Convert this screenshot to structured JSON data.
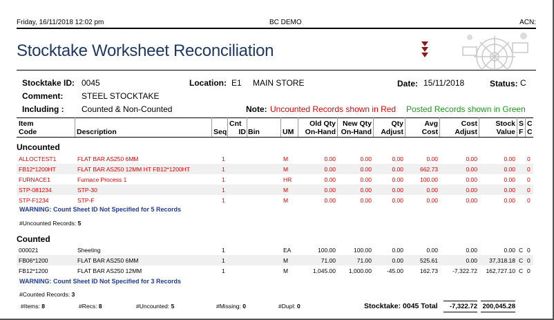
{
  "header": {
    "datetime": "Friday, 16/11/2018 12:02 pm",
    "company": "BC DEMO",
    "acn": "ACN:"
  },
  "title": "Stocktake Worksheet Reconciliation",
  "info": {
    "stocktake_id_label": "Stocktake ID:",
    "stocktake_id": "0045",
    "location_label": "Location:",
    "location_code": "E1",
    "location_name": "MAIN STORE",
    "date_label": "Date:",
    "date": "15/11/2018",
    "status_label": "Status:",
    "status": "C",
    "comment_label": "Comment:",
    "comment": "STEEL STOCKTAKE",
    "including_label": "Including :",
    "including": "Counted & Non-Counted",
    "note_label": "Note:",
    "note_red": "Uncounted Records shown in Red",
    "note_green": "Posted Records shown in Green"
  },
  "columns": {
    "item_code_1": "Item",
    "item_code_2": "Code",
    "description": "Description",
    "seq": "Seq",
    "cnt_1": "Cnt",
    "cnt_2": "ID",
    "bin": "Bin",
    "um": "UM",
    "old_qty_1": "Old Qty",
    "old_qty_2": "On-Hand",
    "new_qty_1": "New Qty",
    "new_qty_2": "On-Hand",
    "qty_adj_1": "Qty",
    "qty_adj_2": "Adjust",
    "avg_cost_1": "Avg",
    "avg_cost_2": "Cost",
    "cost_adj_1": "Cost",
    "cost_adj_2": "Adjust",
    "stock_val_1": "Stock",
    "stock_val_2": "Value",
    "sf_1": "S",
    "sf_2": "F",
    "cc_1": "C",
    "cc_2": "C"
  },
  "uncounted": {
    "title": "Uncounted",
    "rows": [
      {
        "code": "ALLOCTEST1",
        "desc": "FLAT BAR AS250 6MM",
        "seq": "1",
        "um": "M",
        "old": "0.00",
        "new": "0.00",
        "adj": "0.00",
        "avg": "0.00",
        "cadj": "0.00",
        "val": "0.00",
        "cc": "0"
      },
      {
        "code": "FB12*1200HT",
        "desc": "FLAT BAR AS250 12MM HT FB12*1200HT",
        "seq": "1",
        "um": "M",
        "old": "0.00",
        "new": "0.00",
        "adj": "0.00",
        "avg": "662.73",
        "cadj": "0.00",
        "val": "0.00",
        "cc": "0"
      },
      {
        "code": "FURNACE1",
        "desc": "Furnace Process 1",
        "seq": "1",
        "um": "HR",
        "old": "0.00",
        "new": "0.00",
        "adj": "0.00",
        "avg": "100.00",
        "cadj": "0.00",
        "val": "0.00",
        "cc": "0"
      },
      {
        "code": "STP-081234",
        "desc": "STP-30",
        "seq": "1",
        "um": "M",
        "old": "0.00",
        "new": "0.00",
        "adj": "0.00",
        "avg": "0.00",
        "cadj": "0.00",
        "val": "0.00",
        "cc": "0"
      },
      {
        "code": "STP-F1234",
        "desc": "STP-F",
        "seq": "1",
        "um": "M",
        "old": "0.00",
        "new": "0.00",
        "adj": "0.00",
        "avg": "0.00",
        "cadj": "0.00",
        "val": "0.00",
        "cc": "0"
      }
    ],
    "warning": "WARNING: Count Sheet ID Not Specified for 5 Records",
    "count_label": "#Uncounted Records:",
    "count": "5"
  },
  "counted": {
    "title": "Counted",
    "rows": [
      {
        "code": "000021",
        "desc": "Sheeting",
        "seq": "1",
        "um": "EA",
        "old": "100.00",
        "new": "100.00",
        "adj": "0.00",
        "avg": "0.00",
        "cadj": "0.00",
        "val": "0.00",
        "s": "C",
        "cc": "0"
      },
      {
        "code": "FB06*1200",
        "desc": "FLAT BAR AS250 6MM",
        "seq": "1",
        "um": "M",
        "old": "71.00",
        "new": "71.00",
        "adj": "0.00",
        "avg": "525.61",
        "cadj": "0.00",
        "val": "37,318.18",
        "s": "C",
        "cc": "0"
      },
      {
        "code": "FB12*1200",
        "desc": "FLAT BAR AS250 12MM",
        "seq": "1",
        "um": "M",
        "old": "1,045.00",
        "new": "1,000.00",
        "adj": "-45.00",
        "avg": "162.73",
        "cadj": "-7,322.72",
        "val": "162,727.10",
        "s": "C",
        "cc": "0"
      }
    ],
    "warning": "WARNING: Count Sheet ID Not Specified for 3 Records",
    "count_label": "#Counted Records:",
    "count": "3"
  },
  "footer": {
    "items_label": "#Items:",
    "items": "8",
    "recs_label": "#Recs:",
    "recs": "8",
    "uncounted_label": "#Uncounted:",
    "uncounted": "5",
    "missing_label": "#Missing:",
    "missing": "0",
    "dupl_label": "#Dupl:",
    "dupl": "0",
    "total_label": "Stocktake: 0045 Total",
    "total_cost_adj": "-7,322.72",
    "total_value": "200,045.28"
  }
}
